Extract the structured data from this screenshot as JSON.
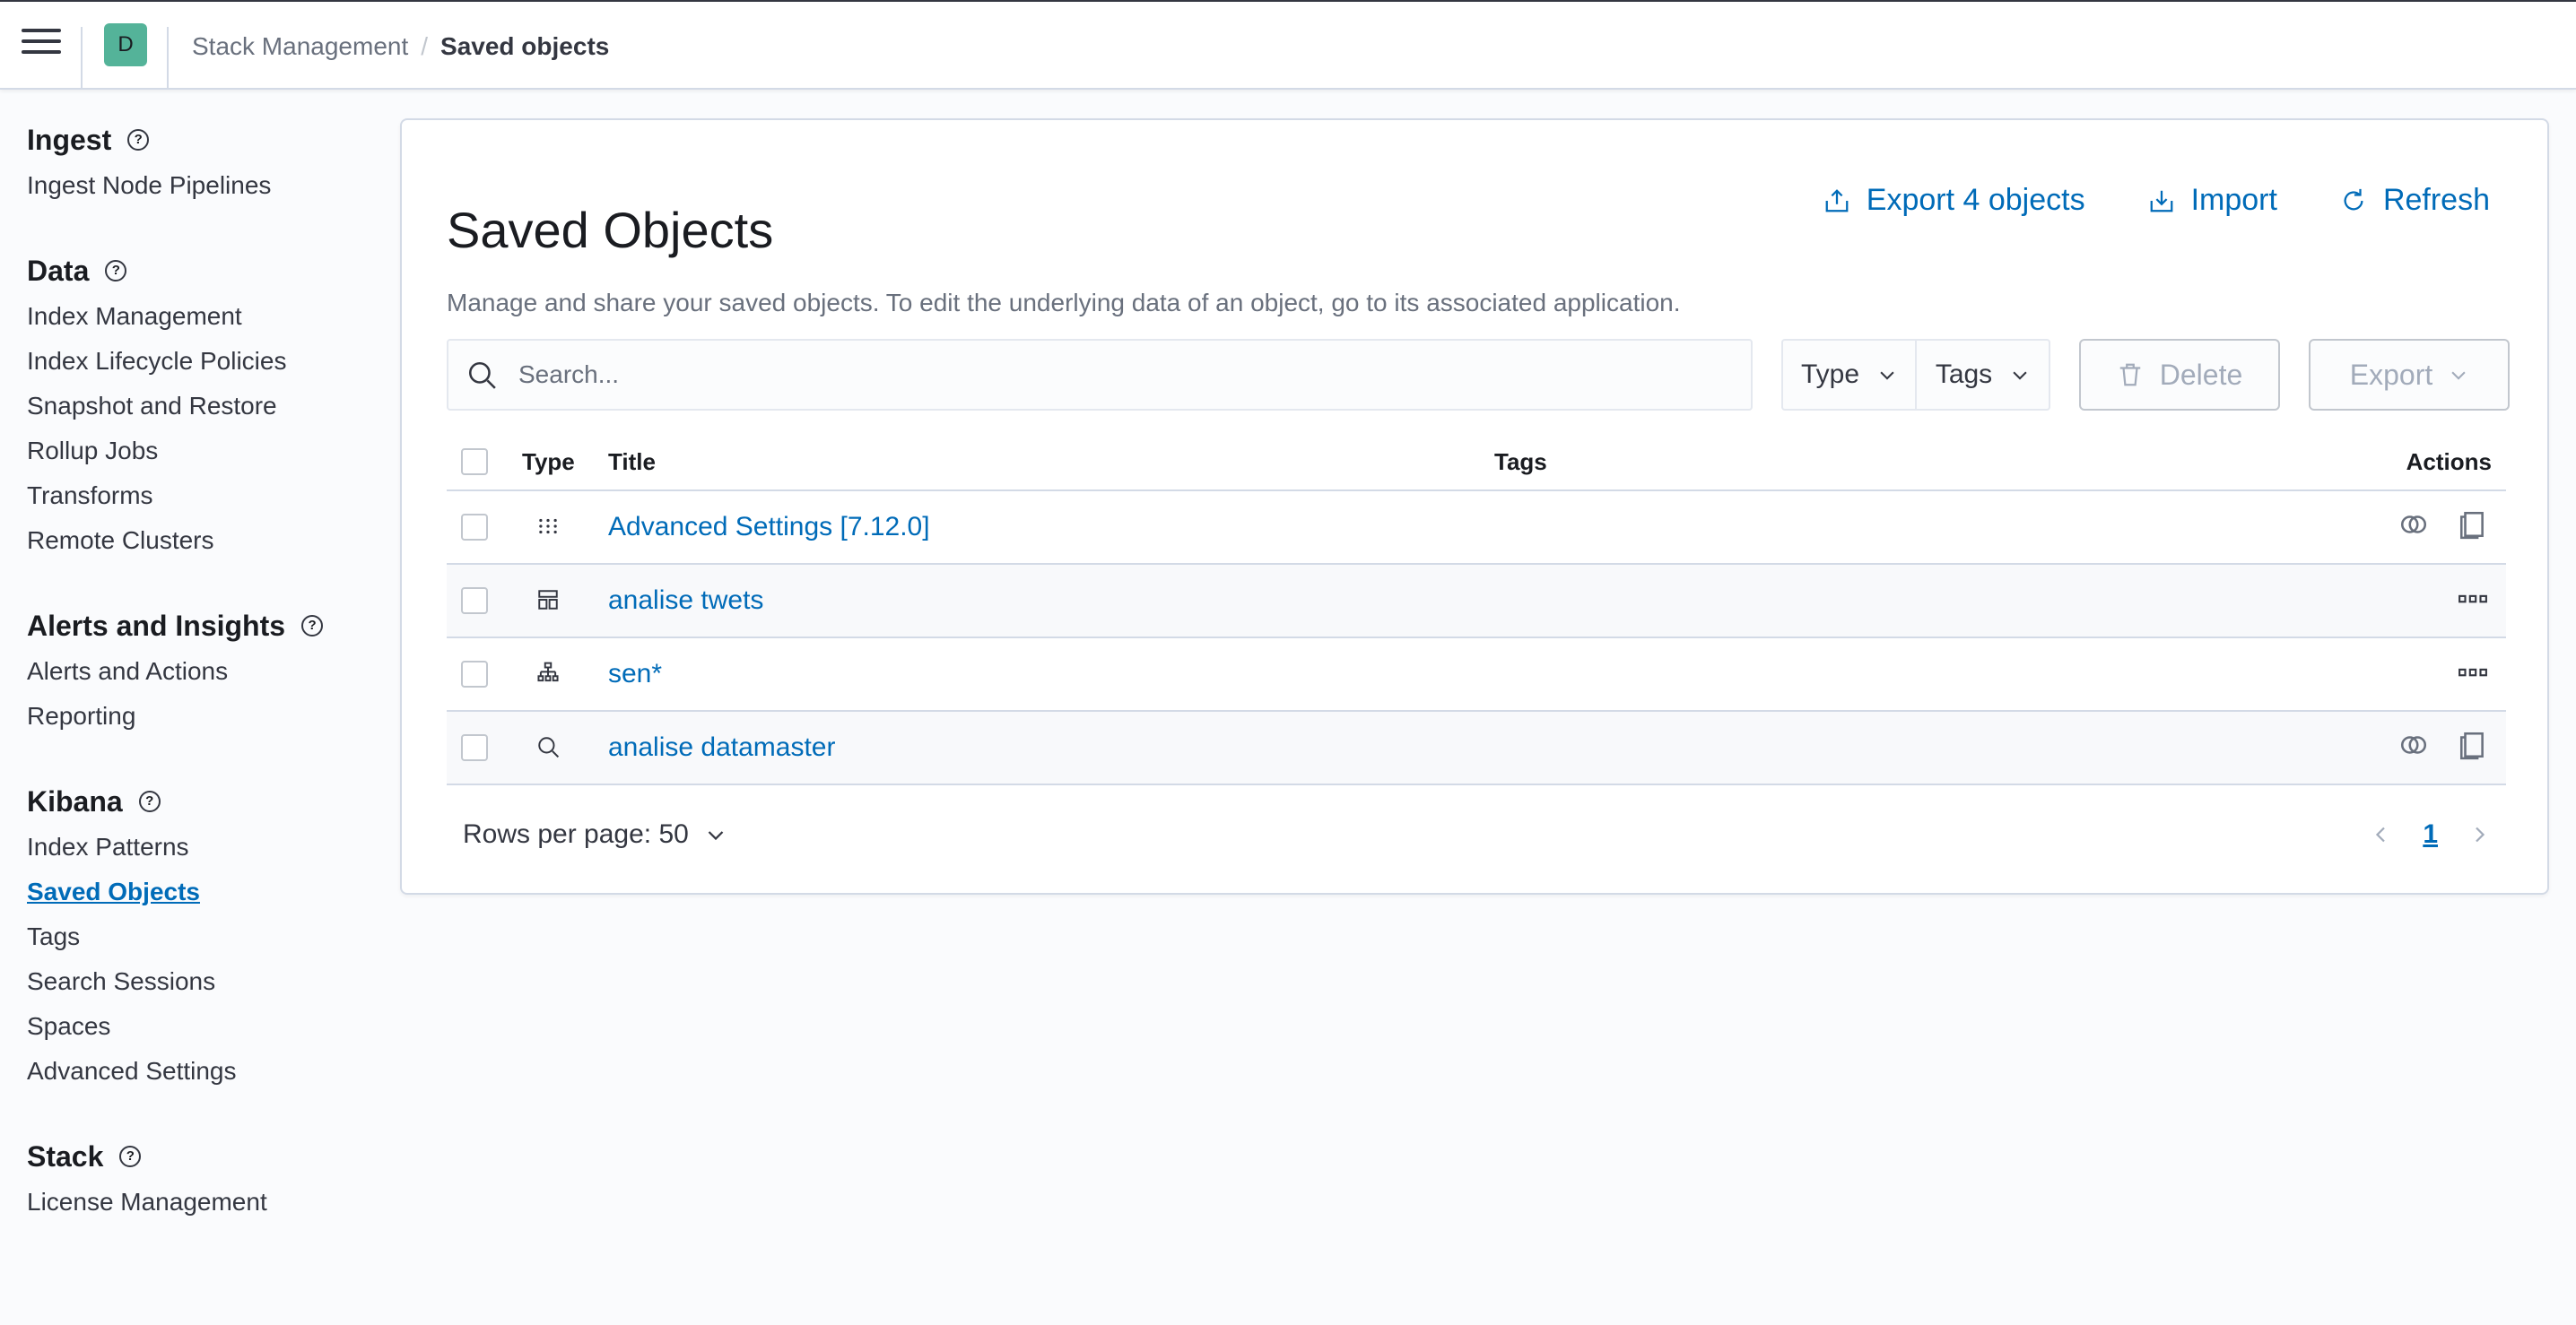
{
  "header": {
    "space_initial": "D",
    "breadcrumbs": [
      "Stack Management",
      "Saved objects"
    ]
  },
  "sidebar": {
    "groups": [
      {
        "title": "Ingest",
        "items": [
          "Ingest Node Pipelines"
        ]
      },
      {
        "title": "Data",
        "items": [
          "Index Management",
          "Index Lifecycle Policies",
          "Snapshot and Restore",
          "Rollup Jobs",
          "Transforms",
          "Remote Clusters"
        ]
      },
      {
        "title": "Alerts and Insights",
        "items": [
          "Alerts and Actions",
          "Reporting"
        ]
      },
      {
        "title": "Kibana",
        "items": [
          "Index Patterns",
          "Saved Objects",
          "Tags",
          "Search Sessions",
          "Spaces",
          "Advanced Settings"
        ],
        "active": "Saved Objects"
      },
      {
        "title": "Stack",
        "items": [
          "License Management"
        ]
      }
    ]
  },
  "main": {
    "title": "Saved Objects",
    "description": "Manage and share your saved objects. To edit the underlying data of an object, go to its associated application.",
    "actions": {
      "export": "Export 4 objects",
      "import": "Import",
      "refresh": "Refresh"
    },
    "search": {
      "placeholder": "Search...",
      "value": ""
    },
    "filters": {
      "type": "Type",
      "tags": "Tags"
    },
    "delete_label": "Delete",
    "export_label": "Export",
    "table": {
      "columns": {
        "type": "Type",
        "title": "Title",
        "tags": "Tags",
        "actions": "Actions"
      },
      "rows": [
        {
          "type_icon": "advanced-settings-icon",
          "title": "Advanced Settings [7.12.0]",
          "actions": [
            "relationships-icon",
            "inspect-icon"
          ]
        },
        {
          "type_icon": "dashboard-icon",
          "title": "analise twets",
          "actions": [
            "more-icon"
          ]
        },
        {
          "type_icon": "index-pattern-icon",
          "title": "sen*",
          "actions": [
            "more-icon"
          ]
        },
        {
          "type_icon": "search-icon",
          "title": "analise datamaster",
          "actions": [
            "relationships-icon",
            "inspect-icon"
          ]
        }
      ]
    },
    "rows_per_page": "Rows per page: 50",
    "page": "1"
  },
  "colors": {
    "accent": "#006bb8",
    "avatar": "#54b399",
    "text": "#343741"
  }
}
